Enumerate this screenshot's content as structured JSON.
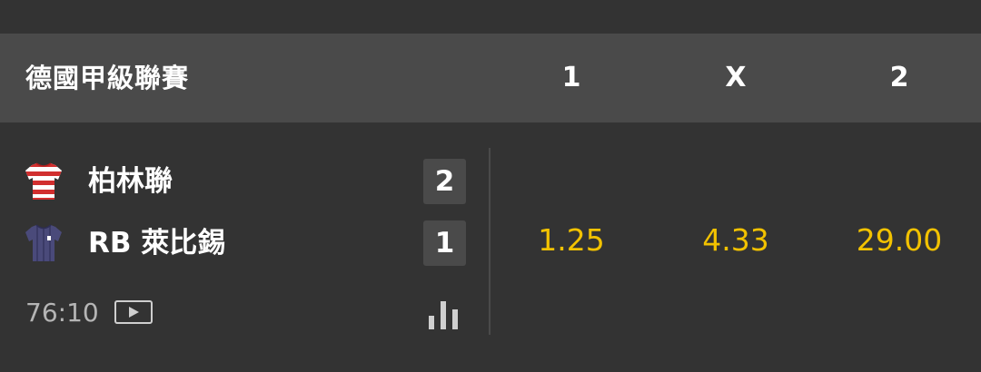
{
  "header": {
    "league": "德國甲級聯賽",
    "col_home": "1",
    "col_draw": "X",
    "col_away": "2"
  },
  "match": {
    "home_team": "柏林聯",
    "away_team": "RB 萊比錫",
    "home_score": "2",
    "away_score": "1",
    "time": "76:10",
    "odds": {
      "home": "1.25",
      "draw": "4.33",
      "away": "29.00"
    }
  },
  "icons": {
    "home_jersey": "red-white-striped-jersey-icon",
    "away_jersey": "navy-jersey-icon",
    "play": "play-video-icon",
    "stats": "bar-chart-icon"
  },
  "colors": {
    "background": "#333333",
    "header_bg": "#4a4a4a",
    "odds": "#f2c200",
    "text": "#ffffff"
  }
}
